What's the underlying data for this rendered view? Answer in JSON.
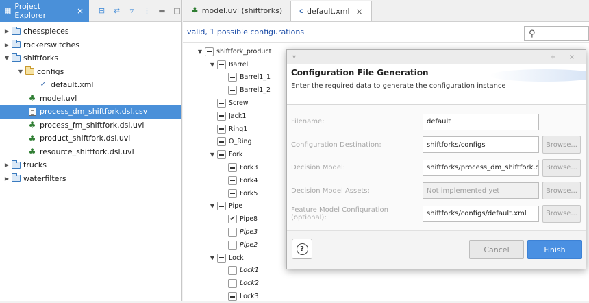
{
  "project_explorer": {
    "tab_label": "Project Explorer",
    "close_glyph": "×",
    "items": [
      {
        "label": "chesspieces",
        "icon": "folder-icon"
      },
      {
        "label": "rockerswitches",
        "icon": "folder-icon"
      },
      {
        "label": "shiftforks",
        "icon": "folder-icon"
      },
      {
        "label": "configs",
        "icon": "open-folder-icon"
      },
      {
        "label": "default.xml",
        "icon": "xml-file-icon"
      },
      {
        "label": "model.uvl",
        "icon": "feature-model-icon"
      },
      {
        "label": "process_dm_shiftfork.dsl.csv",
        "icon": "csv-file-icon"
      },
      {
        "label": "process_fm_shiftfork.dsl.uvl",
        "icon": "feature-model-icon"
      },
      {
        "label": "product_shiftfork.dsl.uvl",
        "icon": "feature-model-icon"
      },
      {
        "label": "resource_shiftfork.dsl.uvl",
        "icon": "feature-model-icon"
      },
      {
        "label": "trucks",
        "icon": "folder-icon"
      },
      {
        "label": "waterfilters",
        "icon": "folder-icon"
      }
    ]
  },
  "editor": {
    "tabs": [
      {
        "label": "model.uvl (shiftforks)"
      },
      {
        "label": "default.xml",
        "close": "×"
      }
    ],
    "status": "valid, 1 possible configurations",
    "search_icon": "search-icon",
    "feature_tree": [
      {
        "label": "shiftfork_product",
        "state": "mixed"
      },
      {
        "label": "Barrel",
        "state": "mixed"
      },
      {
        "label": "Barrel1_1",
        "state": "mixed"
      },
      {
        "label": "Barrel1_2",
        "state": "mixed"
      },
      {
        "label": "Screw",
        "state": "mixed"
      },
      {
        "label": "Jack1",
        "state": "mixed"
      },
      {
        "label": "Ring1",
        "state": "mixed"
      },
      {
        "label": "O_Ring",
        "state": "mixed"
      },
      {
        "label": "Fork",
        "state": "mixed"
      },
      {
        "label": "Fork3",
        "state": "mixed"
      },
      {
        "label": "Fork4",
        "state": "mixed"
      },
      {
        "label": "Fork5",
        "state": "mixed"
      },
      {
        "label": "Pipe",
        "state": "mixed"
      },
      {
        "label": "Pipe8",
        "state": "checked"
      },
      {
        "label": "Pipe3",
        "state": "unchecked"
      },
      {
        "label": "Pipe2",
        "state": "unchecked"
      },
      {
        "label": "Lock",
        "state": "mixed"
      },
      {
        "label": "Lock1",
        "state": "unchecked"
      },
      {
        "label": "Lock2",
        "state": "unchecked"
      },
      {
        "label": "Lock3",
        "state": "mixed"
      }
    ]
  },
  "dialog": {
    "title_bar_controls": "+ ×",
    "title": "Configuration File Generation",
    "subtitle": "Enter the required data to generate the configuration instance",
    "fields": [
      {
        "label": "Filename:",
        "value": "default",
        "button": ""
      },
      {
        "label": "Configuration Destination:",
        "value": "shiftforks/configs",
        "button": "Browse..."
      },
      {
        "label": "Decision Model:",
        "value": "shiftforks/process_dm_shiftfork.ds",
        "button": "Browse..."
      },
      {
        "label": "Decision Model Assets:",
        "value": "Not implemented yet",
        "button": "Browse..."
      },
      {
        "label": "Feature Model Configuration (optional):",
        "value": "shiftforks/configs/default.xml",
        "button": "Browse..."
      }
    ],
    "help_glyph": "?",
    "cancel_label": "Cancel",
    "finish_label": "Finish"
  },
  "colors": {
    "selection": "#4a90d9",
    "status_text": "#1f4fa8",
    "finish_button": "#4a90e2"
  }
}
